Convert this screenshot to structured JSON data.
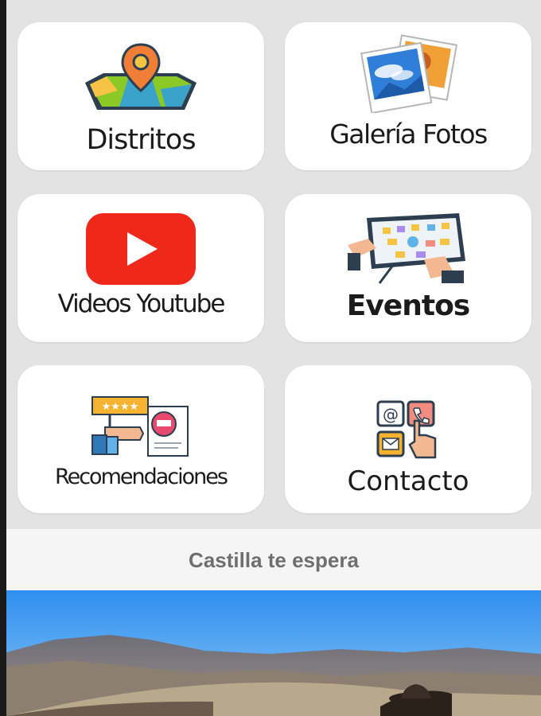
{
  "menu": {
    "items": [
      {
        "label": "Distritos",
        "icon": "map-pin-icon"
      },
      {
        "label": "Galería Fotos",
        "icon": "photo-gallery-icon"
      },
      {
        "label": "Videos Youtube",
        "icon": "youtube-icon"
      },
      {
        "label": "Eventos",
        "icon": "event-board-icon"
      },
      {
        "label": "Recomendaciones",
        "icon": "recommendation-icon"
      },
      {
        "label": "Contacto",
        "icon": "contact-icon"
      }
    ]
  },
  "banner": {
    "tagline": "Castilla te espera",
    "image": "landscape-photo"
  },
  "colors": {
    "background": "#e3e3e3",
    "card": "#ffffff",
    "youtube_red": "#f0281b",
    "tagline_text": "#6f6f6f"
  }
}
